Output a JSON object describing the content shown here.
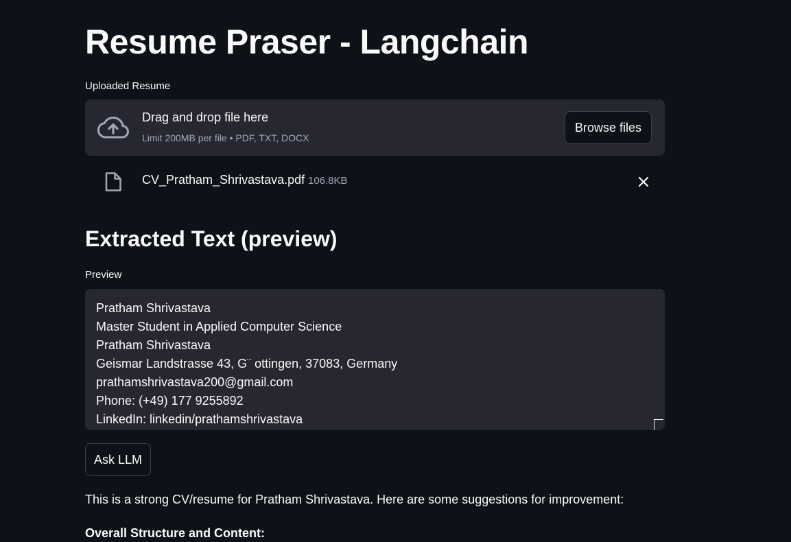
{
  "page": {
    "title": "Resume Praser - Langchain"
  },
  "uploader": {
    "label": "Uploaded Resume",
    "drop_text": "Drag and drop file here",
    "limit_text": "Limit 200MB per file • PDF, TXT, DOCX",
    "browse_label": "Browse files",
    "icon": "cloud-upload-icon"
  },
  "uploaded_file": {
    "name": "CV_Pratham_Shrivastava.pdf",
    "size": "106.8KB",
    "icon": "file-icon"
  },
  "extracted": {
    "heading": "Extracted Text (preview)",
    "preview_label": "Preview",
    "lines": [
      "Pratham Shrivastava",
      "Master Student in Applied Computer Science",
      "Pratham Shrivastava",
      "Geismar Landstrasse 43, G¨ ottingen, 37083, Germany",
      "prathamshrivastava200@gmail.com",
      "Phone: (+49) 177 9255892",
      "LinkedIn: linkedin/prathamshrivastava"
    ]
  },
  "actions": {
    "ask_label": "Ask LLM"
  },
  "response": {
    "intro": "This is a strong CV/resume for Pratham Shrivastava. Here are some suggestions for improvement:",
    "section_heading": "Overall Structure and Content:"
  },
  "colors": {
    "background": "#0e1117",
    "surface": "#262730",
    "text": "#fafafa",
    "muted": "#a3a8b8",
    "border": "#3d404a"
  }
}
